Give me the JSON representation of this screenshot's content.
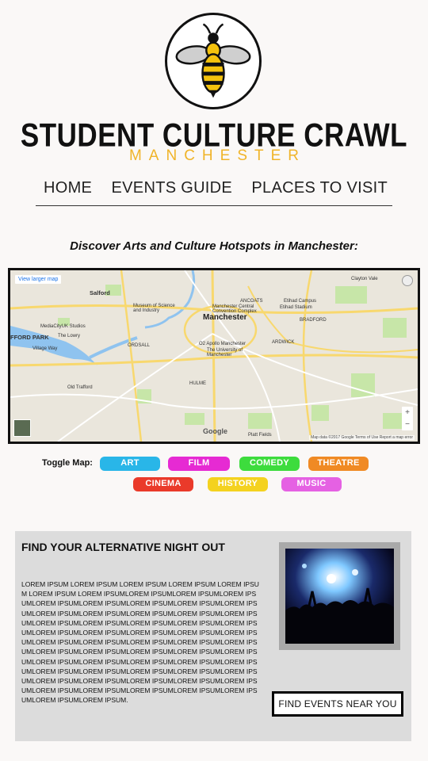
{
  "brand": {
    "title": "STUDENT CULTURE CRAWL",
    "subtitle": "MANCHESTER",
    "logo_icon": "bee-icon"
  },
  "nav": {
    "items": [
      {
        "label": "HOME"
      },
      {
        "label": "EVENTS GUIDE"
      },
      {
        "label": "PLACES TO VISIT"
      }
    ]
  },
  "tagline": "Discover Arts and Culture Hotspots in Manchester:",
  "map": {
    "view_larger": "View larger map",
    "center_label": "Manchester",
    "labels": {
      "salford": "Salford",
      "manchester": "Manchester",
      "museum": "Museum of Science and Industry",
      "central": "Manchester Central Convention Complex",
      "apollo": "O2 Apollo Manchester",
      "university": "The University of Manchester",
      "mediacity": "MediaCityUK Studios",
      "lowry": "The Lowry",
      "trafford_park": "FFORD PARK",
      "old_trafford": "Old Trafford",
      "hulme": "HULME",
      "ancoats": "ANCOATS",
      "etihad_campus": "Etihad Campus",
      "etihad_stadium": "Etihad Stadium",
      "clayton_vale": "Clayton Vale",
      "bradford": "BRADFORD",
      "ardwick": "ARDWICK",
      "platt_fields": "Platt Fields",
      "village_way": "Village Way",
      "ordsall": "ORDSALL"
    },
    "attribution": "Map data ©2017 Google   Terms of Use   Report a map error",
    "google": "Google",
    "zoom_in": "+",
    "zoom_out": "−"
  },
  "toggle": {
    "label": "Toggle Map:",
    "buttons": [
      {
        "label": "ART",
        "color": "#29b6e8"
      },
      {
        "label": "FILM",
        "color": "#e62ad3"
      },
      {
        "label": "COMEDY",
        "color": "#3ddc3d"
      },
      {
        "label": "THEATRE",
        "color": "#f08a24"
      },
      {
        "label": "CINEMA",
        "color": "#ea3a2a"
      },
      {
        "label": "HISTORY",
        "color": "#f4d21f"
      },
      {
        "label": "MUSIC",
        "color": "#e561e3"
      }
    ]
  },
  "panel": {
    "title": "FIND YOUR ALTERNATIVE NIGHT OUT",
    "body": "LOREM IPSUM LOREM IPSUM LOREM IPSUM LOREM IPSUM LOREM IPSUM LOREM IPSUM LOREM IPSUMLOREM IPSUMLOREM IPSUMLOREM IPSUMLOREM IPSUMLOREM IPSUMLOREM IPSUMLOREM IPSUMLOREM IPSUMLOREM IPSUMLOREM IPSUMLOREM IPSUMLOREM IPSUMLOREM IPSUMLOREM IPSUMLOREM IPSUMLOREM IPSUMLOREM IPSUMLOREM IPSUMLOREM IPSUMLOREM IPSUMLOREM IPSUMLOREM IPSUMLOREM IPSUMLOREM IPSUMLOREM IPSUMLOREM IPSUMLOREM IPSUMLOREM IPSUMLOREM IPSUMLOREM IPSUMLOREM IPSUMLOREM IPSUMLOREM IPSUMLOREM IPSUMLOREM IPSUMLOREM IPSUMLOREM IPSUMLOREM IPSUMLOREM IPSUMLOREM IPSUMLOREM IPSUMLOREM IPSUMLOREM IPSUMLOREM IPSUMLOREM IPSUMLOREM IPSUMLOREM IPSUMLOREM IPSUMLOREM IPSUMLOREM IPSUMLOREM IPSUMLOREM IPSUMLOREM IPSUMLOREM IPSUMLOREM IPSUM.",
    "cta": "FIND EVENTS NEAR YOU",
    "photo_icon": "concert-crowd-photo"
  }
}
